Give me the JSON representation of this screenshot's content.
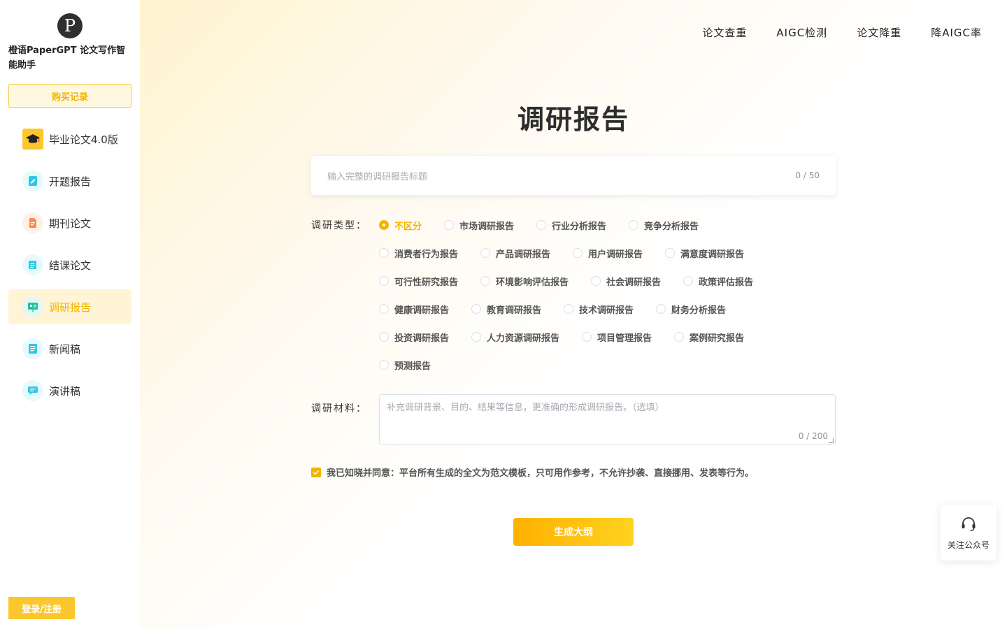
{
  "app": {
    "brand": "橙语PaperGPT 论文写作智能助手",
    "logo_letter": "P"
  },
  "sidebar": {
    "purchase_label": "购买记录",
    "items": [
      {
        "label": "毕业论文4.0版",
        "icon": "graduation-cap-icon",
        "color": "#222222"
      },
      {
        "label": "开题报告",
        "icon": "edit-note-icon",
        "color": "#2ec7e6"
      },
      {
        "label": "期刊论文",
        "icon": "document-icon",
        "color": "#ff8a4c"
      },
      {
        "label": "结课论文",
        "icon": "scroll-icon",
        "color": "#2ec7e6"
      },
      {
        "label": "调研报告",
        "icon": "presentation-icon",
        "color": "#21c19a",
        "active": true
      },
      {
        "label": "新闻稿",
        "icon": "news-icon",
        "color": "#2ec7e6"
      },
      {
        "label": "演讲稿",
        "icon": "speech-icon",
        "color": "#2ec7e6"
      }
    ],
    "login_label": "登录/注册"
  },
  "topnav": [
    "论文查重",
    "AIGC检测",
    "论文降重",
    "降AIGC率"
  ],
  "main": {
    "title": "调研报告",
    "title_input": {
      "placeholder": "输入完整的调研报告标题",
      "counter": "0 / 50"
    },
    "type_label": "调研类型：",
    "types": [
      [
        "不区分",
        "市场调研报告",
        "行业分析报告",
        "竞争分析报告"
      ],
      [
        "消费者行为报告",
        "产品调研报告",
        "用户调研报告",
        "满意度调研报告"
      ],
      [
        "可行性研究报告",
        "环境影响评估报告",
        "社会调研报告",
        "政策评估报告"
      ],
      [
        "健康调研报告",
        "教育调研报告",
        "技术调研报告",
        "财务分析报告"
      ],
      [
        "投资调研报告",
        "人力资源调研报告",
        "项目管理报告",
        "案例研究报告"
      ],
      [
        "预测报告"
      ]
    ],
    "selected_type": "不区分",
    "material_label": "调研材料：",
    "material_input": {
      "placeholder": "补充调研背景、目的、结果等信息，更准确的形成调研报告。（选填）",
      "counter": "0 / 200"
    },
    "agree_text": "我已知晓并同意：平台所有生成的全文为范文模板，只可用作参考，不允许抄袭、直接挪用、发表等行为。",
    "generate_label": "生成大纲"
  },
  "follow": {
    "label": "关注公众号",
    "icon": "headset-icon"
  },
  "colors": {
    "accent": "#f2b400",
    "button": "#fcc72c"
  }
}
